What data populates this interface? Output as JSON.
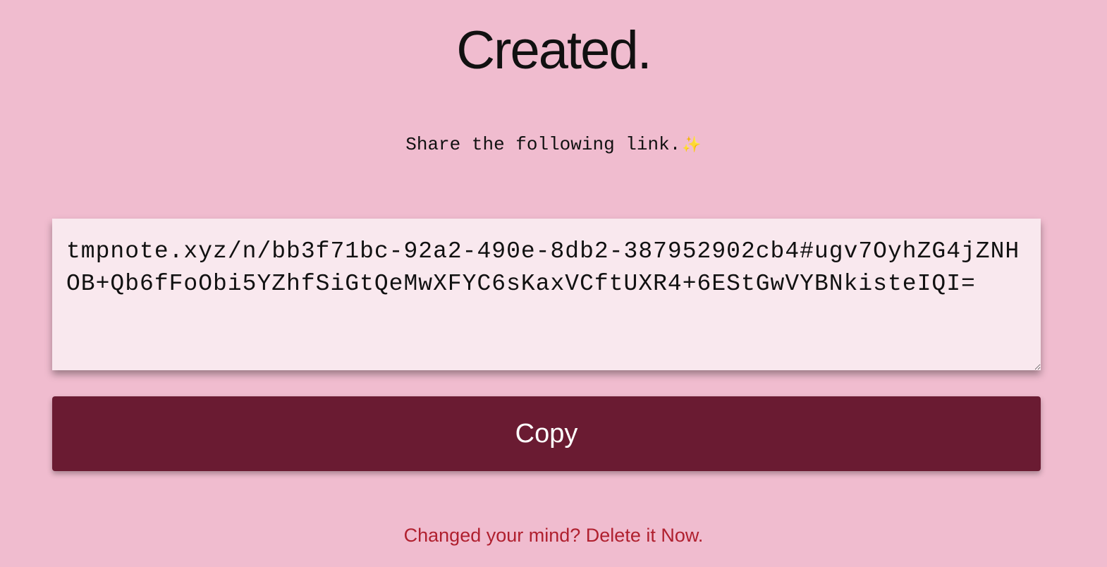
{
  "header": {
    "title": "Created."
  },
  "share": {
    "instruction": "Share the following link.",
    "sparkle": "✨"
  },
  "link_box": {
    "value": "tmpnote.xyz/n/bb3f71bc-92a2-490e-8db2-387952902cb4#ugv7OyhZG4jZNHOB+Qb6fFoObi5YZhfSiGtQeMwXFYC6sKaxVCftUXR4+6EStGwVYBNkisteIQI="
  },
  "actions": {
    "copy_label": "Copy",
    "delete_text": "Changed your mind? Delete it Now."
  },
  "colors": {
    "background": "#f0bccf",
    "button": "#6a1b32",
    "delete_link": "#b0202f"
  }
}
